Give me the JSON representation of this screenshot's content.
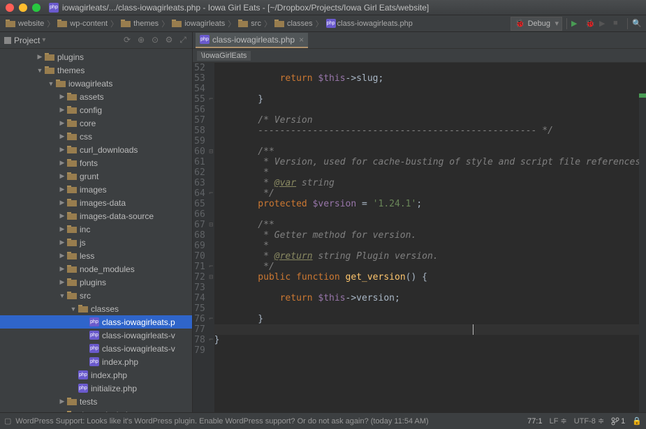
{
  "title": "iowagirleats/.../class-iowagirleats.php - Iowa Girl Eats - [~/Dropbox/Projects/Iowa Girl Eats/website]",
  "breadcrumbs": [
    "website",
    "wp-content",
    "themes",
    "iowagirleats",
    "src",
    "classes",
    "class-iowagirleats.php"
  ],
  "run_config": "Debug",
  "panel": {
    "title": "Project"
  },
  "tree": {
    "plugins": "plugins",
    "themes": "themes",
    "iowagirleats": "iowagirleats",
    "assets": "assets",
    "config": "config",
    "core": "core",
    "css": "css",
    "curl_downloads": "curl_downloads",
    "fonts": "fonts",
    "grunt": "grunt",
    "images": "images",
    "images-data": "images-data",
    "images-data-source": "images-data-source",
    "inc": "inc",
    "js": "js",
    "less": "less",
    "node_modules": "node_modules",
    "plugins2": "plugins",
    "src": "src",
    "classes": "classes",
    "f1": "class-iowagirleats.p",
    "f2": "class-iowagirleats-v",
    "f3": "class-iowagirleats-v",
    "f4": "index.php",
    "f5": "index.php",
    "f6": "initialize.php",
    "tests": "tests",
    "theme_includes": "theme-includes"
  },
  "tab": {
    "name": "class-iowagirleats.php"
  },
  "inner_crumb": "\\IowaGirlEats",
  "lines": [
    "52",
    "53",
    "54",
    "55",
    "56",
    "57",
    "58",
    "59",
    "60",
    "61",
    "62",
    "63",
    "64",
    "65",
    "66",
    "67",
    "68",
    "69",
    "70",
    "71",
    "72",
    "73",
    "74",
    "75",
    "76",
    "77",
    "78",
    "79"
  ],
  "code": {
    "l52": "",
    "l53_kw": "return",
    "l53_var": "$this",
    "l53_rest": "->slug;",
    "l55_brace": "}",
    "l57_c1": "/* Version",
    "l58_c1": "--------------------------------------------------- */",
    "l60_c": "/**",
    "l61_c": " * Version, used for cache-busting of style and script file references.",
    "l62_c": " *",
    "l63_c1": " * ",
    "l63_tag": "@var",
    "l63_c2": " string",
    "l64_c": " */",
    "l65_kw": "protected",
    "l65_var": "$version",
    "l65_sy": " = ",
    "l65_str": "'1.24.1'",
    "l65_end": ";",
    "l67_c": "/**",
    "l68_c": " * Getter method for version.",
    "l69_c": " *",
    "l70_c1": " * ",
    "l70_tag": "@return",
    "l70_c2": " string Plugin version.",
    "l71_c": " */",
    "l72_kw1": "public",
    "l72_kw2": "function",
    "l72_fn": "get_version",
    "l72_end": "() {",
    "l74_kw": "return",
    "l74_var": "$this",
    "l74_rest": "->version;",
    "l76_brace": "}",
    "l78_brace": "}"
  },
  "status": {
    "msg": "WordPress Support: Looks like it's WordPress plugin. Enable WordPress support? Or do not ask again? (today 11:54 AM)",
    "pos": "77:1",
    "le": "LF",
    "enc": "UTF-8",
    "branch": "1"
  }
}
